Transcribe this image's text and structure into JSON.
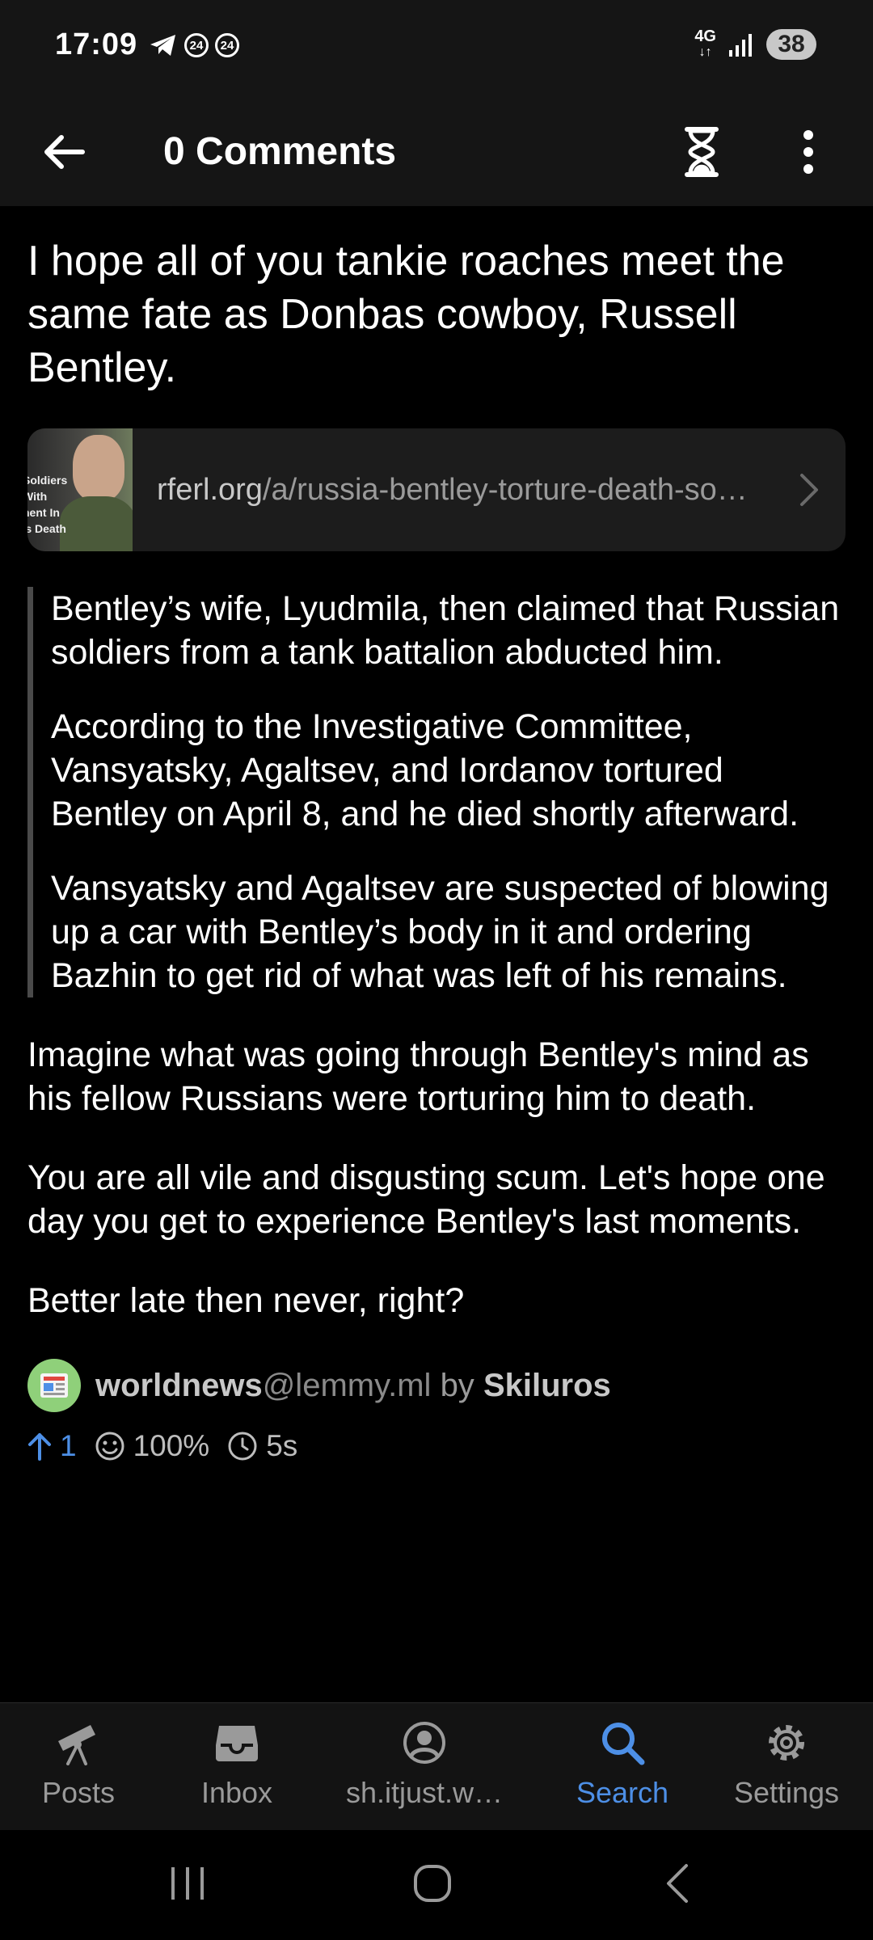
{
  "status_bar": {
    "time": "17:09",
    "notif_badge_1": "24",
    "notif_badge_2": "24",
    "network": "4G",
    "battery": "38"
  },
  "app_bar": {
    "title": "0 Comments"
  },
  "post": {
    "title": "I hope all of you tankie roaches meet the same fate as Donbas cowboy, Russell Bentley.",
    "link": {
      "domain": "rferl.org",
      "path": "/a/russia-bentley-torture-death-so…",
      "thumbnail_text": "Soldiers\nWith\nnent In\n's Death"
    },
    "quote_paragraphs": [
      "Bentley’s wife, Lyudmila, then claimed that Russian soldiers from a tank battalion abducted him.",
      "According to the Investigative Committee, Vansyatsky, Agaltsev, and Iordanov tortured Bentley on April 8, and he died shortly afterward.",
      "Vansyatsky and Agaltsev are suspected of blowing up a car with Bentley’s body in it and ordering Bazhin to get rid of what was left of his remains."
    ],
    "body_paragraphs": [
      "Imagine what was going through Bentley's mind as his fellow Russians were torturing him to death.",
      "You are all vile and disgusting scum. Let's hope one day you get to experience Bentley's last moments.",
      "Better late then never, right?"
    ],
    "community_name": "worldnews",
    "community_instance": "@lemmy.ml",
    "by_label": "by",
    "author": "Skiluros",
    "score": "1",
    "upvote_percent": "100%",
    "age": "5s"
  },
  "bottom_nav": {
    "items": [
      {
        "label": "Posts",
        "icon": "telescope-icon"
      },
      {
        "label": "Inbox",
        "icon": "inbox-icon"
      },
      {
        "label": "sh.itjust.w…",
        "icon": "account-icon"
      },
      {
        "label": "Search",
        "icon": "search-icon",
        "active": true
      },
      {
        "label": "Settings",
        "icon": "gear-icon"
      }
    ]
  },
  "colors": {
    "accent": "#4d8fe6",
    "background": "#000000",
    "bar_background": "#151515",
    "card_background": "#1c1c1c"
  }
}
